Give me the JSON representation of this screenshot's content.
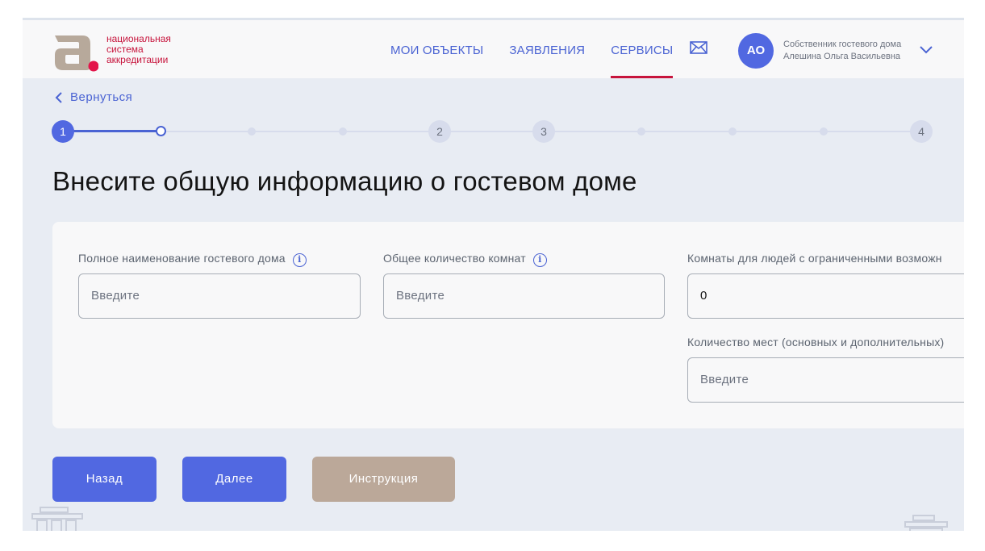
{
  "header": {
    "logo": {
      "lines": [
        "национальная",
        "система",
        "аккредитации"
      ]
    },
    "nav": [
      {
        "label": "МОИ ОБЪЕКТЫ",
        "active": false
      },
      {
        "label": "ЗАЯВЛЕНИЯ",
        "active": false
      },
      {
        "label": "СЕРВИСЫ",
        "active": true
      }
    ],
    "mail_icon": "envelope-icon",
    "user": {
      "initials": "АО",
      "role": "Собственник гостевого дома",
      "name": "Алешина Ольга Васильевна"
    }
  },
  "back_label": "Вернуться",
  "stepper": {
    "steps": [
      "1",
      "2",
      "3",
      "4"
    ],
    "current_step": "1"
  },
  "page_title": "Внесите общую информацию о гостевом доме",
  "form": {
    "fields": [
      {
        "label": "Полное наименование гостевого дома",
        "has_info": true,
        "value": "",
        "placeholder": "Введите"
      },
      {
        "label": "Общее количество комнат",
        "has_info": true,
        "value": "",
        "placeholder": "Введите"
      },
      {
        "label": "Комнаты для людей с ограниченными возможн",
        "has_info": false,
        "value": "0",
        "placeholder": ""
      },
      {
        "label": "Количество мест (основных и дополнительных)",
        "has_info": false,
        "value": "",
        "placeholder": "Введите"
      }
    ]
  },
  "buttons": {
    "back": "Назад",
    "next": "Далее",
    "instruction": "Инструкция"
  },
  "colors": {
    "primary": "#5168e1",
    "accent": "#c7143c",
    "secondary_button": "#bba899",
    "background": "#e8ecf3"
  }
}
